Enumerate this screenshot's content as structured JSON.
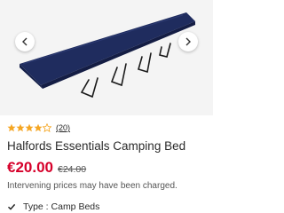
{
  "product": {
    "image_icon": "camping-bed-image",
    "rating_value": 4,
    "rating_max": 5,
    "review_count_text": "(20)",
    "title": "Halfords Essentials Camping Bed",
    "price": "€20.00",
    "was_price": "€24.00",
    "price_note": "Intervening prices may have been charged.",
    "attribute": "Type : Camp Beds"
  },
  "gallery": {
    "prev_icon": "chevron-left-icon",
    "next_icon": "chevron-right-icon"
  },
  "colors": {
    "price": "#d6002a",
    "star_fill": "#f5a623",
    "bed_fabric": "#1f2c5e"
  }
}
